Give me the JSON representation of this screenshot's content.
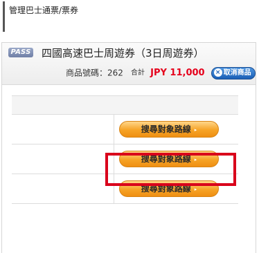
{
  "breadcrumb": "管理巴士通票/票券",
  "product": {
    "badge": "PASS",
    "title": "四國高速巴士周遊券（3日周遊券）",
    "code_label": "商品號碼：",
    "code_value": "262",
    "total_label": "合計",
    "price": "JPY 11,000",
    "cancel_label": "取消商品",
    "cancel_icon": "×"
  },
  "routes": {
    "rows": [
      {
        "button_label": "搜尋對象路線"
      },
      {
        "button_label": "搜尋對象路線"
      },
      {
        "button_label": "搜尋對象路線"
      }
    ],
    "arrow_icon": "▸"
  },
  "colors": {
    "price": "#e5001b",
    "highlight": "#d9001b",
    "button_orange": "#f6a326",
    "cancel_blue": "#1a5fb6"
  }
}
